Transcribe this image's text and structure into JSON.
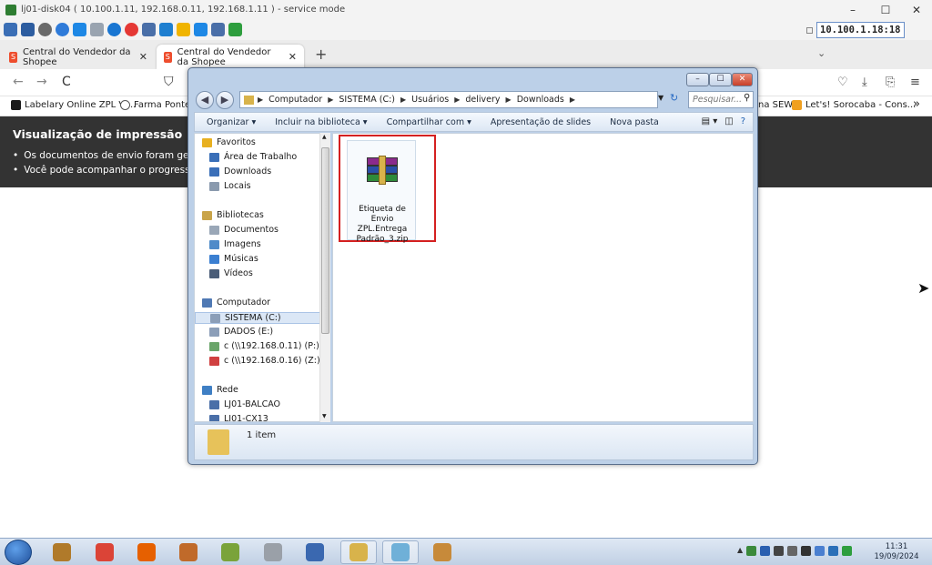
{
  "remote_session": {
    "title": "lj01-disk04 ( 10.100.1.11, 192.168.0.11, 192.168.1.11 ) - service mode",
    "ip_field": "10.100.1.18:18",
    "controls": [
      "–",
      "☐",
      "✕"
    ]
  },
  "browser": {
    "tabs": [
      {
        "label": "Central do Vendedor da Shopee",
        "active": false
      },
      {
        "label": "Central do Vendedor da Shopee",
        "active": true
      }
    ],
    "new_tab": "+",
    "tab_list": "⌄",
    "nav": {
      "back": "←",
      "forward": "→",
      "reload": "C"
    },
    "bookmarks": [
      {
        "label": "Labelary Online ZPL Vi...",
        "color": "#1a1a1a"
      },
      {
        "label": "Farma Ponte ::",
        "color": "#555555"
      },
      {
        "label": "na SEW",
        "color": "#888888"
      },
      {
        "label": "Let's! Sorocaba - Cons...",
        "color": "#f0a020"
      }
    ],
    "more": "»"
  },
  "banner": {
    "title": "Visualização de impressão",
    "items": [
      "Os documentos de envio foram gerado:",
      "Você pode acompanhar o progresso en"
    ]
  },
  "explorer": {
    "controls": {
      "minimize": "–",
      "maximize": "☐",
      "close": "✕"
    },
    "address": [
      "Computador",
      "SISTEMA (C:)",
      "Usuários",
      "delivery",
      "Downloads"
    ],
    "search_placeholder": "Pesquisar...",
    "commands": [
      "Organizar ▾",
      "Incluir na biblioteca ▾",
      "Compartilhar com ▾",
      "Apresentação de slides",
      "Nova pasta"
    ],
    "tree": [
      {
        "label": "Favoritos",
        "indent": 0,
        "color": "#e8b020"
      },
      {
        "label": "Área de Trabalho",
        "indent": 1,
        "color": "#3a6fb8"
      },
      {
        "label": "Downloads",
        "indent": 1,
        "color": "#3a6fb8"
      },
      {
        "label": "Locais",
        "indent": 1,
        "color": "#8a9aae"
      },
      {
        "label": "Bibliotecas",
        "indent": 0,
        "color": "#c9a44a",
        "gap": true
      },
      {
        "label": "Documentos",
        "indent": 1,
        "color": "#9aa7b7"
      },
      {
        "label": "Imagens",
        "indent": 1,
        "color": "#4f8bc9"
      },
      {
        "label": "Músicas",
        "indent": 1,
        "color": "#3b7fd1"
      },
      {
        "label": "Vídeos",
        "indent": 1,
        "color": "#4a5d78"
      },
      {
        "label": "Computador",
        "indent": 0,
        "color": "#4f79b4",
        "gap": true
      },
      {
        "label": "SISTEMA (C:)",
        "indent": 1,
        "color": "#8b9eb8",
        "selected": true
      },
      {
        "label": "DADOS (E:)",
        "indent": 1,
        "color": "#8b9eb8"
      },
      {
        "label": "c (\\\\192.168.0.11) (P:)",
        "indent": 1,
        "color": "#6aa56a"
      },
      {
        "label": "c (\\\\192.168.0.16) (Z:)",
        "indent": 1,
        "color": "#d04040"
      },
      {
        "label": "Rede",
        "indent": 0,
        "color": "#3f7fc4",
        "gap": true
      },
      {
        "label": "LJ01-BALCAO",
        "indent": 1,
        "color": "#4a6fa8"
      },
      {
        "label": "LJ01-CX13",
        "indent": 1,
        "color": "#4a6fa8"
      }
    ],
    "file": {
      "name_lines": [
        "Etiqueta de Envio",
        "ZPL.Entrega",
        "Padrão_3.zip"
      ],
      "icon": "winrar-archive-icon"
    },
    "status": "1 item"
  },
  "taskbar": {
    "apps": [
      {
        "name": "briefcase",
        "color": "#b07a2a"
      },
      {
        "name": "chrome",
        "color": "#db4437"
      },
      {
        "name": "firefox",
        "color": "#e66000"
      },
      {
        "name": "person",
        "color": "#c06a2a"
      },
      {
        "name": "seven-z",
        "color": "#7aa33a"
      },
      {
        "name": "printer",
        "color": "#9aa0a8"
      },
      {
        "name": "vidalink",
        "color": "#3a68b0"
      },
      {
        "name": "explorer",
        "color": "#d8b34b"
      },
      {
        "name": "notes",
        "color": "#6fb0d8"
      },
      {
        "name": "paint",
        "color": "#c78a3a"
      }
    ],
    "clock_time": "11:31",
    "clock_date": "19/09/2024"
  }
}
